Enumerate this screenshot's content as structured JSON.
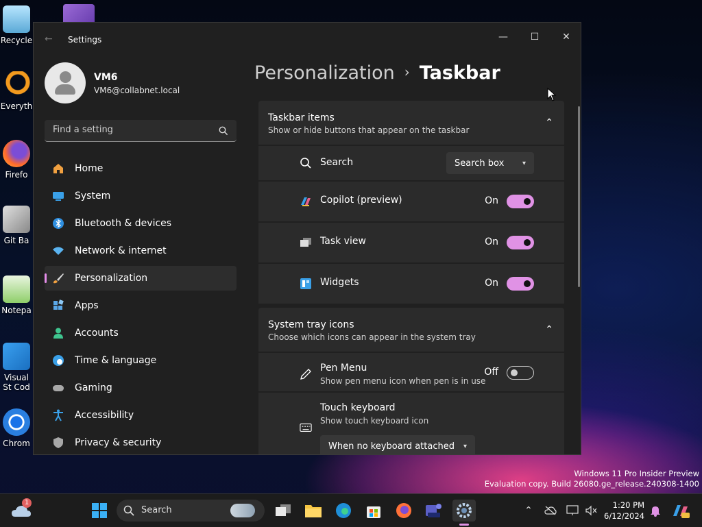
{
  "desktop": {
    "icons": [
      {
        "name": "recycle-bin-icon",
        "label": "Recycle"
      },
      {
        "name": "everything-icon",
        "label": "Everyth"
      },
      {
        "name": "firefox-icon",
        "label": "Firefo"
      },
      {
        "name": "git-bash-icon",
        "label": "Git Ba"
      },
      {
        "name": "notepad-icon",
        "label": "Notepa"
      },
      {
        "name": "vscode-icon",
        "label": "Visual St Cod"
      },
      {
        "name": "chrome-icon",
        "label": "Chrom"
      }
    ],
    "watermark": {
      "line1": "Windows 11 Pro Insider Preview",
      "line2": "Evaluation copy. Build 26080.ge_release.240308-1400"
    }
  },
  "window": {
    "title": "Settings",
    "controls": {
      "minimize": "—",
      "maximize": "☐",
      "close": "✕"
    }
  },
  "user": {
    "name": "VM6",
    "email": "VM6@collabnet.local"
  },
  "search": {
    "placeholder": "Find a setting"
  },
  "nav": [
    {
      "label": "Home",
      "icon": "home-icon",
      "color": "#f0a040"
    },
    {
      "label": "System",
      "icon": "system-icon",
      "color": "#3aa0e8"
    },
    {
      "label": "Bluetooth & devices",
      "icon": "bluetooth-icon",
      "color": "#2f8fe0"
    },
    {
      "label": "Network & internet",
      "icon": "wifi-icon",
      "color": "#5ab3f0"
    },
    {
      "label": "Personalization",
      "icon": "brush-icon",
      "color": "#d9d9d9",
      "active": true
    },
    {
      "label": "Apps",
      "icon": "apps-icon",
      "color": "#5aa7e8"
    },
    {
      "label": "Accounts",
      "icon": "accounts-icon",
      "color": "#3fc58f"
    },
    {
      "label": "Time & language",
      "icon": "globe-icon",
      "color": "#3aa0e8"
    },
    {
      "label": "Gaming",
      "icon": "gaming-icon",
      "color": "#a8a8a8"
    },
    {
      "label": "Accessibility",
      "icon": "accessibility-icon",
      "color": "#3aa0e8"
    },
    {
      "label": "Privacy & security",
      "icon": "shield-icon",
      "color": "#a8a8a8"
    }
  ],
  "breadcrumb": {
    "parent": "Personalization",
    "separator": "›",
    "current": "Taskbar"
  },
  "taskbar_items": {
    "title": "Taskbar items",
    "subtitle": "Show or hide buttons that appear on the taskbar",
    "search": {
      "label": "Search",
      "value": "Search box"
    },
    "copilot": {
      "label": "Copilot (preview)",
      "state": "On"
    },
    "task_view": {
      "label": "Task view",
      "state": "On"
    },
    "widgets": {
      "label": "Widgets",
      "state": "On"
    }
  },
  "system_tray": {
    "title": "System tray icons",
    "subtitle": "Choose which icons can appear in the system tray",
    "pen_menu": {
      "label": "Pen Menu",
      "sub": "Show pen menu icon when pen is in use",
      "state": "Off"
    },
    "touch_keyboard": {
      "label": "Touch keyboard",
      "sub": "Show touch keyboard icon",
      "value": "When no keyboard attached"
    }
  },
  "taskbar": {
    "search_label": "Search",
    "weather_badge": "1",
    "time": "1:20 PM",
    "date": "6/12/2024"
  },
  "colors": {
    "accent": "#e092e5",
    "window_bg": "#202020",
    "card_bg": "#2b2b2b"
  }
}
